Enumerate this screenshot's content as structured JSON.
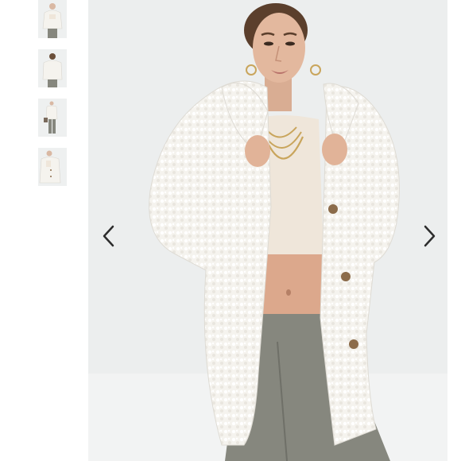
{
  "gallery": {
    "background": "#ffffff",
    "image_background": "#eceeee",
    "product": {
      "jacket_color": "#f5f3ee",
      "top_color": "#efe6da",
      "trousers_color": "#86877e",
      "button_color": "#8b6b4a"
    },
    "thumbnails": [
      {
        "view": "front-closeup"
      },
      {
        "view": "back-view"
      },
      {
        "view": "full-length-front"
      },
      {
        "view": "side-detail"
      }
    ],
    "controls": {
      "prev_icon": "chevron-left-icon",
      "next_icon": "chevron-right-icon",
      "arrow_color": "#2d2d2d"
    }
  }
}
